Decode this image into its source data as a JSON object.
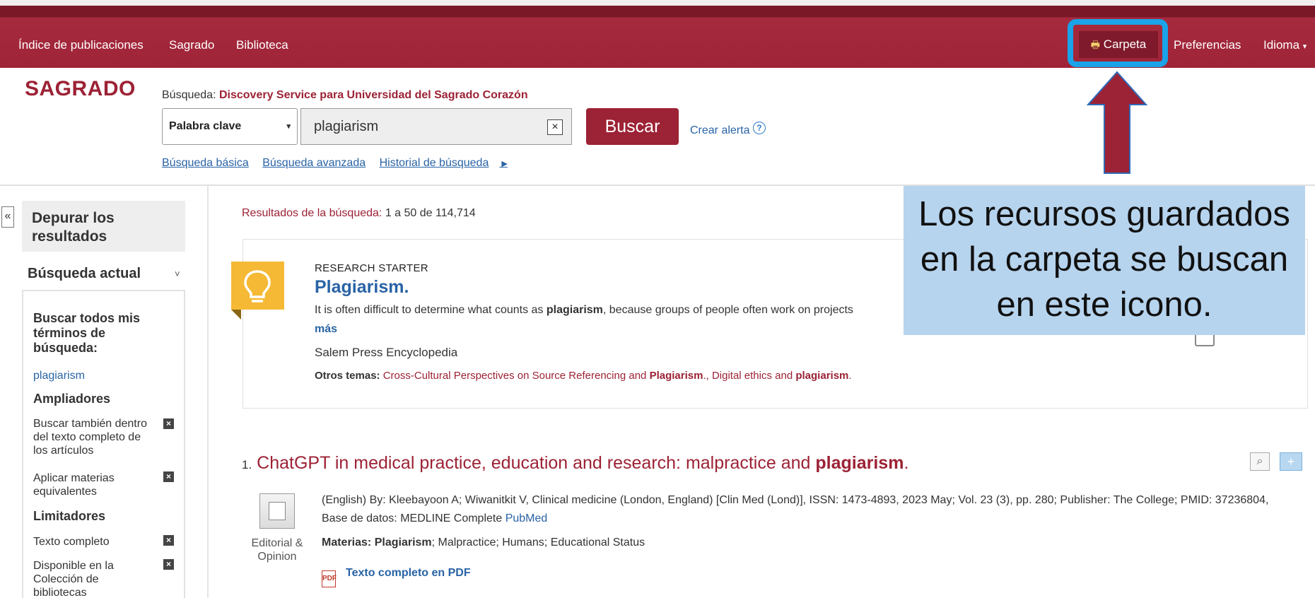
{
  "topnav": {
    "left_items": [
      "Índice de publicaciones",
      "Sagrado",
      "Biblioteca"
    ],
    "carpeta": "Carpeta",
    "preferencias": "Preferencias",
    "idioma": "Idioma"
  },
  "header": {
    "logo": "SAGRADO",
    "search_label": "Búsqueda:",
    "search_source": "Discovery Service para Universidad del Sagrado Corazón",
    "field_select": "Palabra clave",
    "query": "plagiarism",
    "buscar": "Buscar",
    "crear_alerta": "Crear alerta",
    "links": [
      "Búsqueda básica",
      "Búsqueda avanzada",
      "Historial de búsqueda"
    ]
  },
  "sidebar": {
    "collapse": "«",
    "refine_title": "Depurar los resultados",
    "current_search": "Búsqueda actual",
    "find_all_terms": "Buscar todos mis términos de búsqueda:",
    "term": "plagiarism",
    "expanders_title": "Ampliadores",
    "expanders": [
      "Buscar también dentro del texto completo de los artículos",
      "Aplicar materias equivalentes"
    ],
    "limiters_title": "Limitadores",
    "limiters": [
      "Texto completo",
      "Disponible en la Colección de bibliotecas"
    ]
  },
  "results": {
    "count_label": "Resultados de la búsqueda:",
    "count_value": "1 a 50 de 114,714",
    "starter": {
      "label": "RESEARCH STARTER",
      "title": "Plagiarism.",
      "snippet_pre": "It is often difficult to determine what counts as ",
      "snippet_bold": "plagiarism",
      "snippet_post": ", because groups of people often work on projects",
      "more": "más",
      "source": "Salem Press Encyclopedia",
      "topics_label": "Otros temas:",
      "topic1_pre": "Cross-Cultural Perspectives on Source Referencing and ",
      "topic1_bold": "Plagiarism",
      "topic1_post": "., Digital ethics and ",
      "topic2_bold": "plagiarism",
      "topic2_post": "."
    },
    "items": [
      {
        "num": "1.",
        "title_pre": "ChatGPT in medical practice, education and research: malpractice and ",
        "title_bold": "plagiarism",
        "title_post": ".",
        "type": "Editorial & Opinion",
        "meta": "(English) By: Kleebayoon A; Wiwanitkit V, Clinical medicine (London, England) [Clin Med (Lond)], ISSN: 1473-4893, 2023 May; Vol. 23 (3), pp. 280; Publisher: The College; PMID: 37236804, Base de datos: MEDLINE Complete",
        "pubmed": "PubMed",
        "subjects_label": "Materias:",
        "subject_bold": "Plagiarism",
        "subjects_rest": "; Malpractice; Humans; Educational Status",
        "pdf": "Texto completo en PDF"
      }
    ]
  },
  "callout": "Los recursos guardados en la carpeta se buscan en este icono.",
  "colors": {
    "brand": "#9c2235",
    "link": "#2963a5",
    "callout": "#b7d4ee",
    "highlight": "#1aa3e8"
  }
}
